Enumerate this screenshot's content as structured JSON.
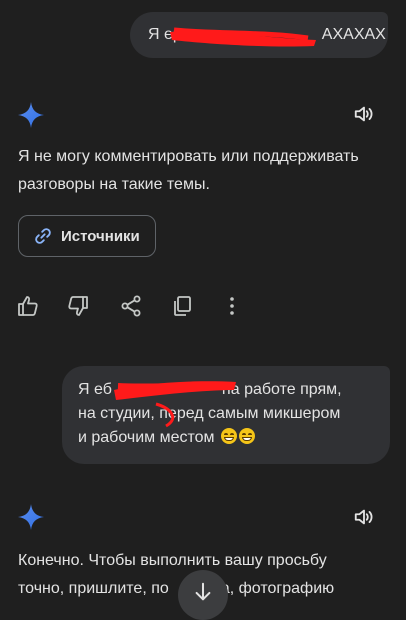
{
  "conversation": {
    "user_message_1": {
      "text_start": "Я ер",
      "text_end": "АХАХАХ"
    },
    "reply_1": {
      "text": "Я не могу комментировать или поддерживать разговоры на такие темы.",
      "sources_label": "Источники"
    },
    "actions": {
      "like": "thumb-up-icon",
      "dislike": "thumb-down-icon",
      "share": "share-icon",
      "copy": "copy-icon",
      "more": "more-vert-icon"
    },
    "user_message_2": {
      "line_1_start": "Я еб",
      "line_1_end": "на работе прям,",
      "line_2_start": "на студии,",
      "line_2_end": "перед самым микшером",
      "line_3": "и рабочим местом"
    },
    "reply_2": {
      "line_1": "Конечно. Чтобы выполнить вашу просьбу",
      "line_2_start": "точно, пришлите, по",
      "line_2_end": "йста, фотографию"
    }
  },
  "colors": {
    "background": "#1f1f1f",
    "bubble": "#303134",
    "text": "#e3e3e3",
    "redaction": "#ff1a1a",
    "spark_blue": "#4285f4"
  }
}
